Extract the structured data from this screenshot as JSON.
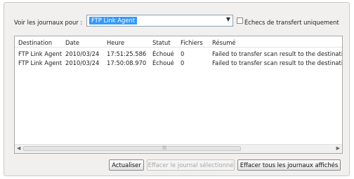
{
  "filter": {
    "label": "Voir les journaux pour :",
    "selected": "FTP Link Agent",
    "dropdown_icon": "chevron-down-icon",
    "failed_only_label": "Échecs de transfert uniquement",
    "failed_only_checked": false
  },
  "log_table": {
    "columns": [
      "Destination",
      "Date",
      "Heure",
      "Statut",
      "Fichiers",
      "Résumé"
    ],
    "rows": [
      [
        "FTP Link Agent",
        "2010/03/24",
        "17:51:25.586",
        "Échoué",
        "0",
        "Failed to transfer scan result to the destinatio"
      ],
      [
        "FTP Link Agent",
        "2010/03/24",
        "17:50:08.970",
        "Échoué",
        "0",
        "Failed to transfer scan result to the destinatio"
      ]
    ]
  },
  "buttons": {
    "refresh": "Actualiser",
    "clear_selected": "Effacer le journal sélectionné",
    "clear_all": "Effacer tous les journaux affichés"
  }
}
